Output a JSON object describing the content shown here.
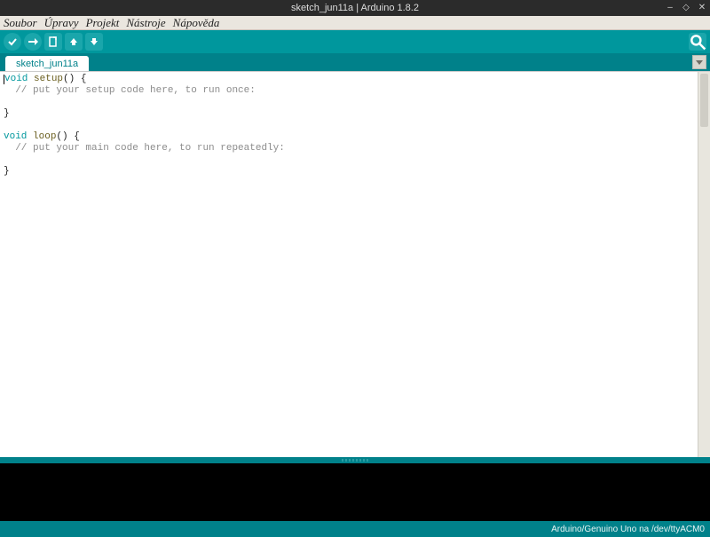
{
  "window": {
    "title": "sketch_jun11a | Arduino 1.8.2"
  },
  "menu": {
    "file": "Soubor",
    "edit": "Úpravy",
    "sketch": "Projekt",
    "tools": "Nástroje",
    "help": "Nápověda"
  },
  "toolbar": {
    "verify": "Verify",
    "upload": "Upload",
    "new": "New",
    "open": "Open",
    "save": "Save",
    "serial_monitor": "Serial Monitor"
  },
  "tabs": [
    {
      "label": "sketch_jun11a"
    }
  ],
  "code": {
    "l1": {
      "kw": "void",
      "fn": "setup",
      "rest": "() {"
    },
    "l2": "// put your setup code here, to run once:",
    "l3": "}",
    "l5": {
      "kw": "void",
      "fn": "loop",
      "rest": "() {"
    },
    "l6": "// put your main code here, to run repeatedly:",
    "l7": "}"
  },
  "status": {
    "board_port": "Arduino/Genuino Uno na /dev/ttyACM0"
  },
  "colors": {
    "teal_toolbar": "#00979d",
    "teal_dark": "#00818a",
    "keyword": "#00979d",
    "function": "#6a5e1e",
    "comment": "#8c8c8c"
  }
}
